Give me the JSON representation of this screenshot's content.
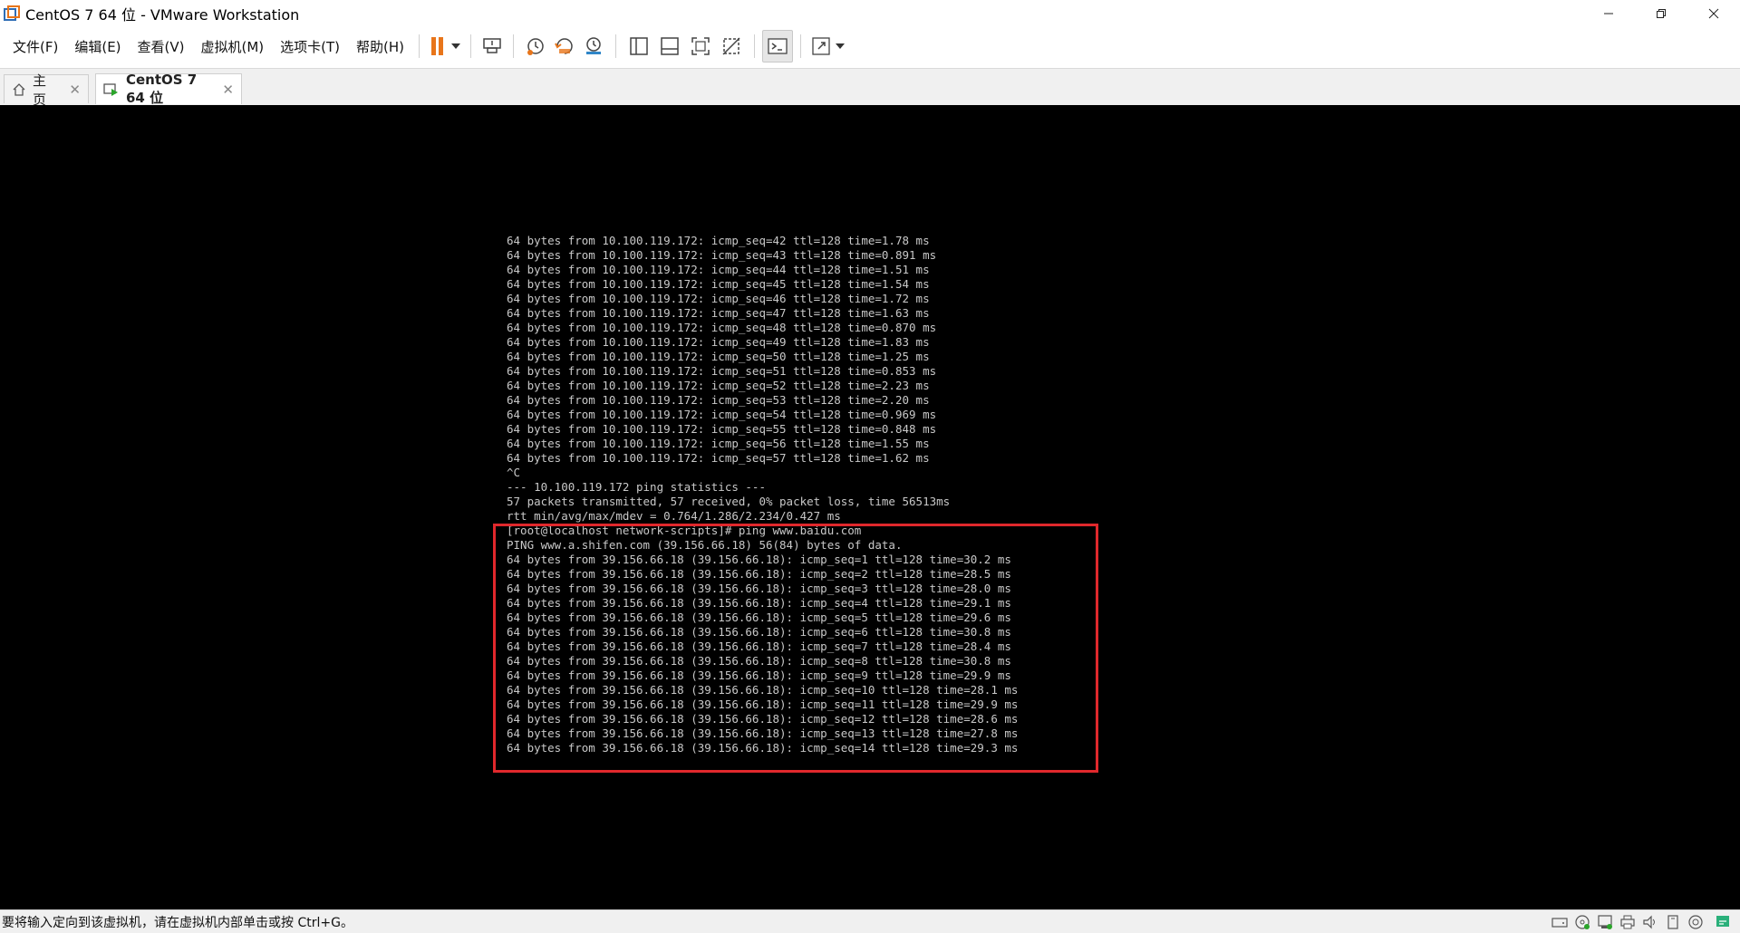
{
  "window": {
    "title": "CentOS 7 64 位 - VMware Workstation",
    "controls": [
      "minimize-icon",
      "restore-icon",
      "close-icon"
    ]
  },
  "menu": {
    "items": [
      "文件(F)",
      "编辑(E)",
      "查看(V)",
      "虚拟机(M)",
      "选项卡(T)",
      "帮助(H)"
    ]
  },
  "toolbar": {
    "icons": [
      "pause-icon",
      "dropdown-icon",
      "send-ctrl-alt-del-icon",
      "snapshot-icon",
      "revert-snapshot-icon",
      "snapshot-manager-icon",
      "library-view-icon",
      "thumbnail-bar-icon",
      "fullscreen-icon",
      "unity-icon",
      "console-view-icon",
      "stretch-icon",
      "dropdown-icon"
    ],
    "pause_color": "#e8751a"
  },
  "tabs": [
    {
      "label": "主页",
      "icon": "home-icon",
      "active": false
    },
    {
      "label": "CentOS 7 64 位",
      "icon": "vm-running-icon",
      "active": true
    }
  ],
  "console": {
    "lines": [
      "64 bytes from 10.100.119.172: icmp_seq=42 ttl=128 time=1.78 ms",
      "64 bytes from 10.100.119.172: icmp_seq=43 ttl=128 time=0.891 ms",
      "64 bytes from 10.100.119.172: icmp_seq=44 ttl=128 time=1.51 ms",
      "64 bytes from 10.100.119.172: icmp_seq=45 ttl=128 time=1.54 ms",
      "64 bytes from 10.100.119.172: icmp_seq=46 ttl=128 time=1.72 ms",
      "64 bytes from 10.100.119.172: icmp_seq=47 ttl=128 time=1.63 ms",
      "64 bytes from 10.100.119.172: icmp_seq=48 ttl=128 time=0.870 ms",
      "64 bytes from 10.100.119.172: icmp_seq=49 ttl=128 time=1.83 ms",
      "64 bytes from 10.100.119.172: icmp_seq=50 ttl=128 time=1.25 ms",
      "64 bytes from 10.100.119.172: icmp_seq=51 ttl=128 time=0.853 ms",
      "64 bytes from 10.100.119.172: icmp_seq=52 ttl=128 time=2.23 ms",
      "64 bytes from 10.100.119.172: icmp_seq=53 ttl=128 time=2.20 ms",
      "64 bytes from 10.100.119.172: icmp_seq=54 ttl=128 time=0.969 ms",
      "64 bytes from 10.100.119.172: icmp_seq=55 ttl=128 time=0.848 ms",
      "64 bytes from 10.100.119.172: icmp_seq=56 ttl=128 time=1.55 ms",
      "64 bytes from 10.100.119.172: icmp_seq=57 ttl=128 time=1.62 ms",
      "^C",
      "--- 10.100.119.172 ping statistics ---",
      "57 packets transmitted, 57 received, 0% packet loss, time 56513ms",
      "rtt min/avg/max/mdev = 0.764/1.286/2.234/0.427 ms",
      "[root@localhost network-scripts]# ping www.baidu.com",
      "PING www.a.shifen.com (39.156.66.18) 56(84) bytes of data.",
      "64 bytes from 39.156.66.18 (39.156.66.18): icmp_seq=1 ttl=128 time=30.2 ms",
      "64 bytes from 39.156.66.18 (39.156.66.18): icmp_seq=2 ttl=128 time=28.5 ms",
      "64 bytes from 39.156.66.18 (39.156.66.18): icmp_seq=3 ttl=128 time=28.0 ms",
      "64 bytes from 39.156.66.18 (39.156.66.18): icmp_seq=4 ttl=128 time=29.1 ms",
      "64 bytes from 39.156.66.18 (39.156.66.18): icmp_seq=5 ttl=128 time=29.6 ms",
      "64 bytes from 39.156.66.18 (39.156.66.18): icmp_seq=6 ttl=128 time=30.8 ms",
      "64 bytes from 39.156.66.18 (39.156.66.18): icmp_seq=7 ttl=128 time=28.4 ms",
      "64 bytes from 39.156.66.18 (39.156.66.18): icmp_seq=8 ttl=128 time=30.8 ms",
      "64 bytes from 39.156.66.18 (39.156.66.18): icmp_seq=9 ttl=128 time=29.9 ms",
      "64 bytes from 39.156.66.18 (39.156.66.18): icmp_seq=10 ttl=128 time=28.1 ms",
      "64 bytes from 39.156.66.18 (39.156.66.18): icmp_seq=11 ttl=128 time=29.9 ms",
      "64 bytes from 39.156.66.18 (39.156.66.18): icmp_seq=12 ttl=128 time=28.6 ms",
      "64 bytes from 39.156.66.18 (39.156.66.18): icmp_seq=13 ttl=128 time=27.8 ms",
      "64 bytes from 39.156.66.18 (39.156.66.18): icmp_seq=14 ttl=128 time=29.3 ms"
    ],
    "highlight_color": "#e0282c"
  },
  "statusbar": {
    "text": "要将输入定向到该虚拟机，请在虚拟机内部单击或按 Ctrl+G。",
    "device_icons": [
      "hard-disk-icon",
      "cd-dvd-icon",
      "network-adapter-icon",
      "printer-icon",
      "sound-card-icon",
      "usb-icon",
      "display-icon",
      "message-icon"
    ]
  }
}
